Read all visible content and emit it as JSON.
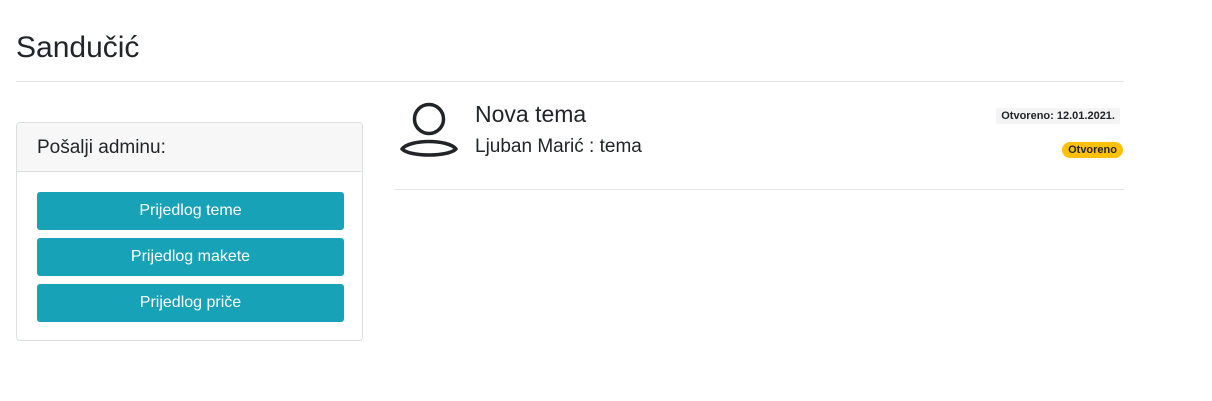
{
  "page": {
    "title": "Sandučić"
  },
  "send_panel": {
    "header": "Pošalji adminu:",
    "buttons": [
      {
        "label": "Prijedlog teme"
      },
      {
        "label": "Prijedlog makete"
      },
      {
        "label": "Prijedlog priče"
      }
    ]
  },
  "messages": [
    {
      "title": "Nova tema",
      "subtitle": "Ljuban Marić : tema",
      "date_label": "Otvoreno:",
      "date": "12.01.2021.",
      "status": "Otvoreno",
      "avatar_icon": "user-icon"
    }
  ],
  "colors": {
    "button_bg": "#17a2b8",
    "status_badge_bg": "#ffc107"
  }
}
